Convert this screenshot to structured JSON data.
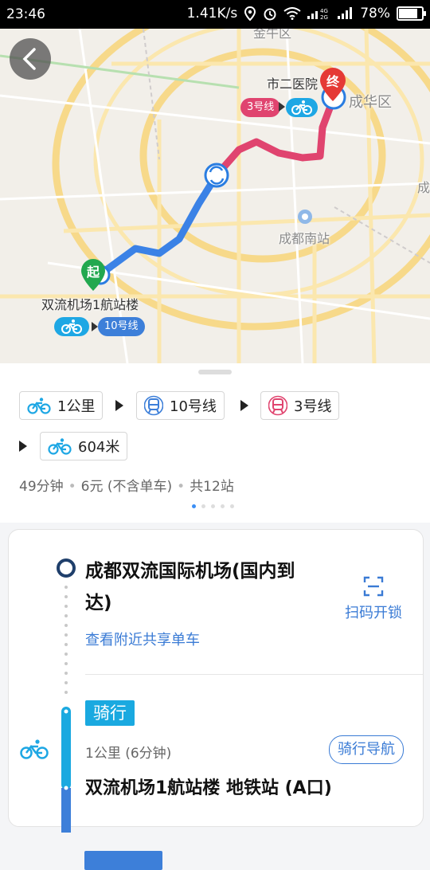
{
  "status_bar": {
    "time": "23:46",
    "speed": "1.41K/s",
    "network": "4G 2G",
    "battery": "78%"
  },
  "map": {
    "labels": {
      "top_district": "金牛区",
      "hospital": "市二医院",
      "chenghua": "成华区",
      "south_station": "成都南站",
      "start_place": "双流机场1航站楼",
      "edge_char": "成"
    },
    "start_marker": "起",
    "end_marker": "终",
    "chips": {
      "line3": "3号线",
      "line10": "10号线"
    },
    "colors": {
      "route_blue": "#3b82e6",
      "route_pink": "#e0446f",
      "start_green": "#22a84f",
      "end_red": "#e53935",
      "bike_blue": "#1ea7e4"
    }
  },
  "summary": {
    "segments": [
      {
        "icon": "bike-icon",
        "label": "1公里"
      },
      {
        "icon": "metro-icon",
        "label": "10号线"
      },
      {
        "icon": "metro-icon",
        "label": "3号线"
      },
      {
        "icon": "bike-icon",
        "label": "604米"
      }
    ],
    "duration": "49分钟",
    "price": "6元 (不含单车)",
    "stops": "共12站",
    "page_indicator": {
      "count": 5,
      "active": 1
    }
  },
  "detail": {
    "start_line1": "成都双流国际机场(国内到",
    "start_line2": "达)",
    "nearby_link": "查看附近共享单车",
    "scan_unlock": "扫码开锁",
    "ride_tag": "骑行",
    "ride_info": "1公里 (6分钟)",
    "ride_nav": "骑行导航",
    "ride_destination": "双流机场1航站楼 地铁站 (A口)"
  }
}
